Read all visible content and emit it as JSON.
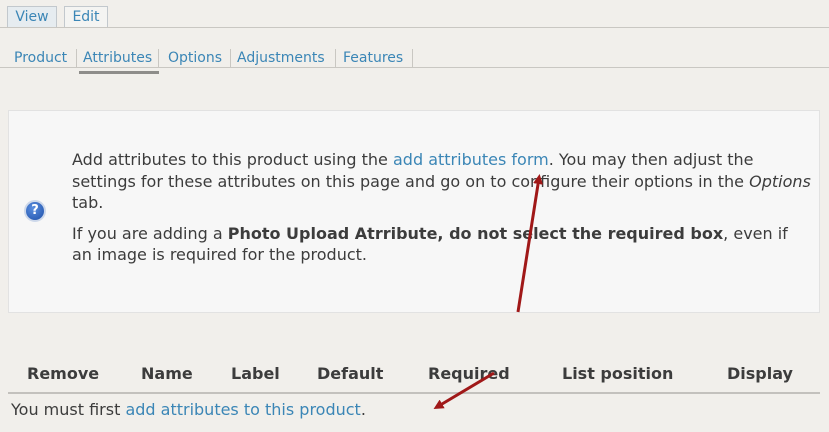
{
  "primary_tabs": [
    {
      "label": "View"
    },
    {
      "label": "Edit"
    }
  ],
  "secondary_tabs": [
    {
      "label": "Product"
    },
    {
      "label": "Attributes",
      "active": true
    },
    {
      "label": "Options"
    },
    {
      "label": "Adjustments"
    },
    {
      "label": "Features"
    }
  ],
  "help": {
    "icon": "question-help-icon",
    "line1_before": "Add attributes to this product using the ",
    "line1_link": "add attributes form",
    "line1_after": ". You may then adjust the settings for these attributes on this page and go on to configure their options in the ",
    "line1_em": "Options",
    "line1_end": " tab.",
    "line2_before": "If you are adding a ",
    "line2_bold": "Photo Upload Atrribute, do not select the required box",
    "line2_after": ", even if an image is required for the product."
  },
  "table": {
    "columns": [
      "Remove",
      "Name",
      "Label",
      "Default",
      "Required",
      "List position",
      "Display"
    ],
    "empty_before": "You must first ",
    "empty_link": "add attributes to this product",
    "empty_after": "."
  },
  "colors": {
    "link": "#3b86b6",
    "annotation_arrow": "#a01818",
    "background": "#f1efeb"
  }
}
